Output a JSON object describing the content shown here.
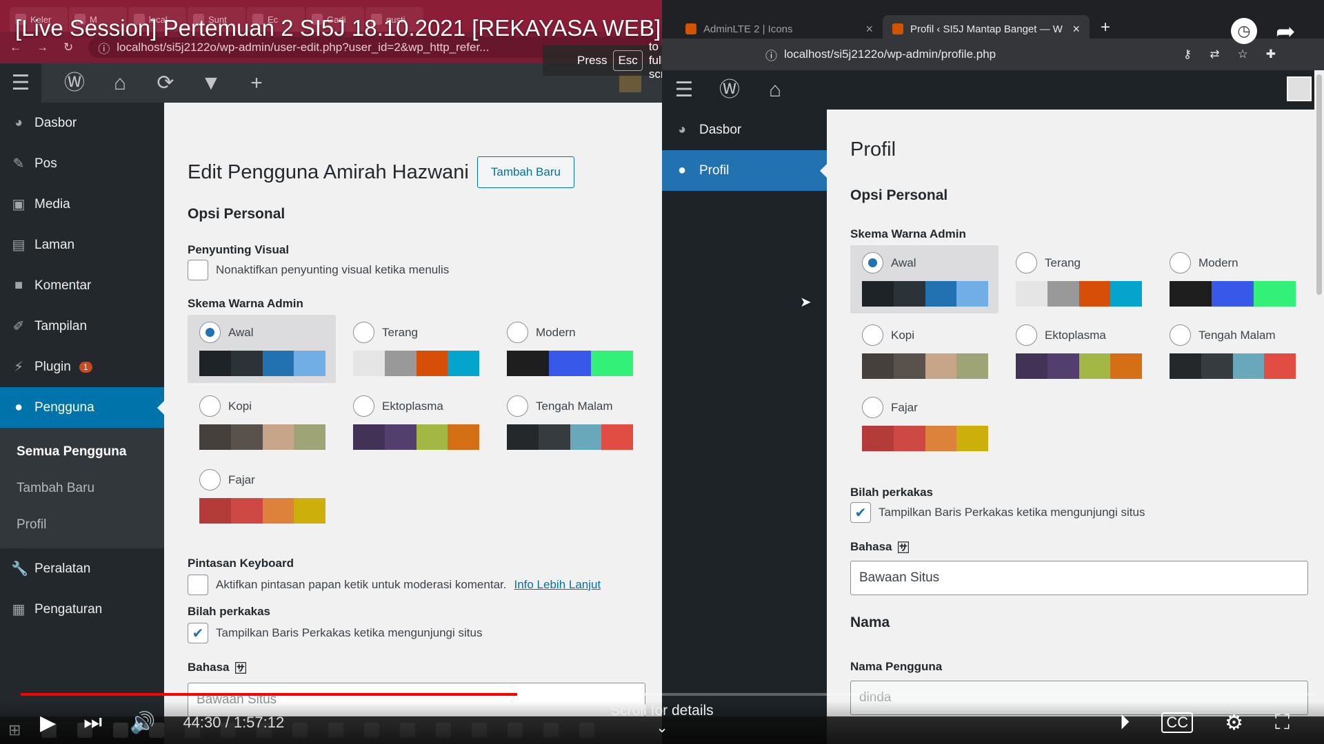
{
  "video": {
    "title": "[Live Session] Pertemuan 2 SI5J 18.10.2021 [REKAYASA WEB]",
    "fullscreen_hint": {
      "pre": "Press",
      "key": "Esc",
      "post": "to exit full screen"
    },
    "time": "44:30 / 1:57:12",
    "progress": 0.383,
    "scroll_hint": "Scroll for details"
  },
  "left": {
    "tabs": [
      "Keler",
      "M",
      "local",
      "Sunt",
      "Ec",
      "Gadi",
      "gusti"
    ],
    "url": "localhost/si5j2122o/wp-admin/user-edit.php?user_id=2&wp_http_refer...",
    "menu": [
      {
        "label": "Dasbor",
        "icon": "dashboard-icon",
        "glyph": "◕"
      },
      {
        "label": "Pos",
        "icon": "pin-icon",
        "glyph": "✎"
      },
      {
        "label": "Media",
        "icon": "media-icon",
        "glyph": "▣"
      },
      {
        "label": "Laman",
        "icon": "page-icon",
        "glyph": "▤"
      },
      {
        "label": "Komentar",
        "icon": "comment-icon",
        "glyph": "■"
      },
      {
        "label": "Tampilan",
        "icon": "brush-icon",
        "glyph": "✐"
      },
      {
        "label": "Plugin",
        "icon": "plugin-icon",
        "glyph": "⚡",
        "badge": "1"
      },
      {
        "label": "Pengguna",
        "icon": "user-icon",
        "glyph": "●"
      }
    ],
    "submenu": [
      "Semua Pengguna",
      "Tambah Baru",
      "Profil"
    ],
    "menu_bottom": [
      {
        "label": "Peralatan",
        "icon": "wrench-icon",
        "glyph": "🔧"
      },
      {
        "label": "Pengaturan",
        "icon": "settings-icon",
        "glyph": "▦"
      }
    ],
    "page_title": "Edit Pengguna Amirah Hazwani",
    "add_new": "Tambah Baru",
    "section": "Opsi Personal",
    "visual_editor": {
      "label": "Penyunting Visual",
      "checkbox": "Nonaktifkan penyunting visual ketika menulis"
    },
    "scheme_label": "Skema Warna Admin",
    "keyboard": {
      "label": "Pintasan Keyboard",
      "checkbox": "Aktifkan pintasan papan ketik untuk moderasi komentar.",
      "link": "Info Lebih Lanjut"
    },
    "toolbar": {
      "label": "Bilah perkakas",
      "checkbox": "Tampilkan Baris Perkakas ketika mengunjungi situs"
    },
    "language": {
      "label": "Bahasa",
      "value": "Bawaan Situs"
    }
  },
  "right": {
    "tabs": [
      {
        "title": "AdminLTE 2 | Icons",
        "active": false
      },
      {
        "title": "Profil ‹ SI5J Mantap Banget — W",
        "active": true
      }
    ],
    "url": "localhost/si5j2122o/wp-admin/profile.php",
    "menu": [
      {
        "label": "Dasbor",
        "icon": "dashboard-icon",
        "glyph": "◕"
      },
      {
        "label": "Profil",
        "icon": "user-icon",
        "glyph": "●"
      }
    ],
    "page_title": "Profil",
    "section": "Opsi Personal",
    "scheme_label": "Skema Warna Admin",
    "toolbar": {
      "label": "Bilah perkakas",
      "checkbox": "Tampilkan Baris Perkakas ketika mengunjungi situs"
    },
    "language": {
      "label": "Bahasa",
      "value": "Bawaan Situs"
    },
    "name_section": "Nama",
    "username": {
      "label": "Nama Pengguna",
      "value": "dinda"
    }
  },
  "schemes": [
    {
      "name": "Awal",
      "colors": [
        "#1d2327",
        "#2c3338",
        "#2271b1",
        "#72aee6"
      ],
      "selected": true
    },
    {
      "name": "Terang",
      "colors": [
        "#e5e5e5",
        "#999999",
        "#d64e07",
        "#04a4cc"
      ],
      "selected": false
    },
    {
      "name": "Modern",
      "colors": [
        "#1e1e1e",
        "#3858e9",
        "#33f078",
        "#33f078"
      ],
      "selected": false
    },
    {
      "name": "Kopi",
      "colors": [
        "#46403c",
        "#59524c",
        "#c7a589",
        "#9ea476"
      ],
      "selected": false
    },
    {
      "name": "Ektoplasma",
      "colors": [
        "#413256",
        "#523f6d",
        "#a3b745",
        "#d46f15"
      ],
      "selected": false
    },
    {
      "name": "Tengah Malam",
      "colors": [
        "#25282b",
        "#363b3f",
        "#69a8bb",
        "#e14d43"
      ],
      "selected": false
    },
    {
      "name": "Fajar",
      "colors": [
        "#b43c38",
        "#cf4944",
        "#dd823b",
        "#ccaf0b"
      ],
      "selected": false
    }
  ]
}
